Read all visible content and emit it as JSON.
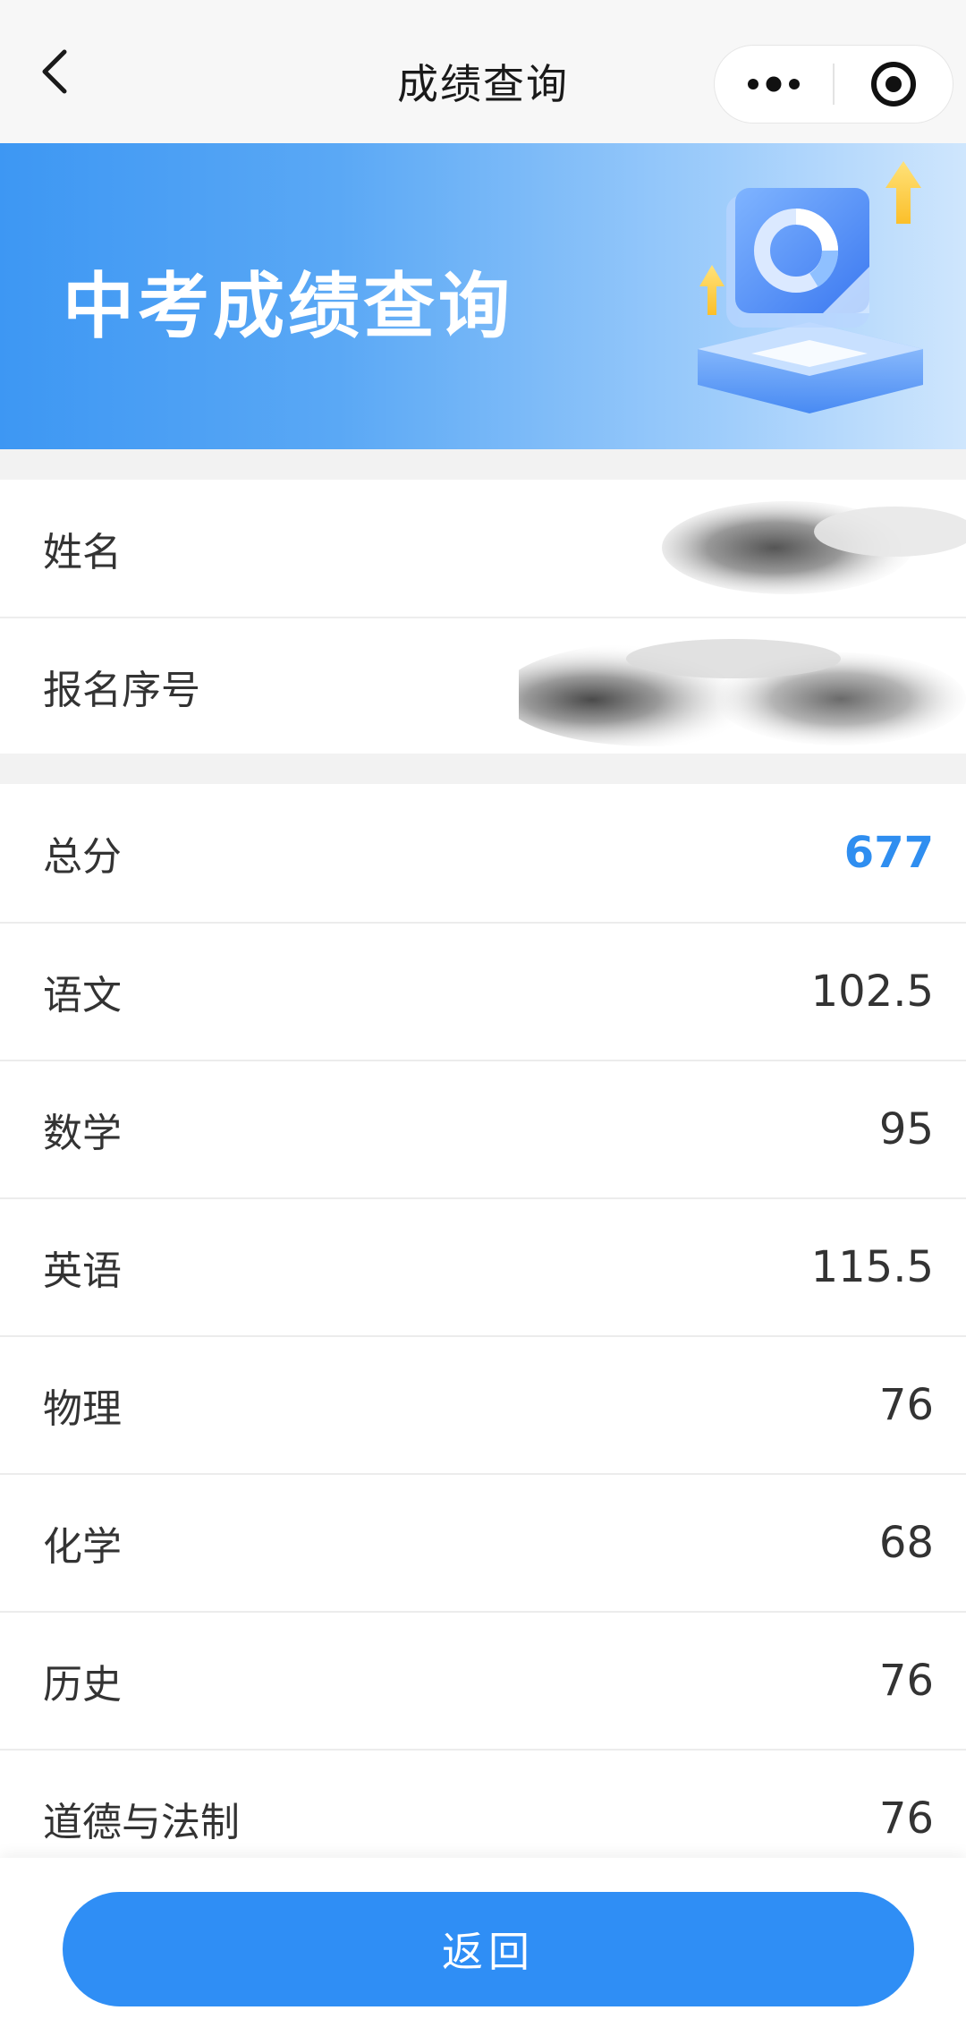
{
  "navbar": {
    "title": "成绩查询",
    "back_icon": "chevron-left-icon",
    "more_icon": "more-dots-icon",
    "close_icon": "target-circle-icon"
  },
  "banner": {
    "title": "中考成绩查询",
    "illustration_icon": "chart-monitor-illustration"
  },
  "info": {
    "rows": [
      {
        "label": "姓名",
        "value": ""
      },
      {
        "label": "报名序号",
        "value": ""
      }
    ]
  },
  "scores": {
    "rows": [
      {
        "label": "总分",
        "value": "677"
      },
      {
        "label": "语文",
        "value": "102.5"
      },
      {
        "label": "数学",
        "value": "95"
      },
      {
        "label": "英语",
        "value": "115.5"
      },
      {
        "label": "物理",
        "value": "76"
      },
      {
        "label": "化学",
        "value": "68"
      },
      {
        "label": "历史",
        "value": "76"
      },
      {
        "label": "道德与法制",
        "value": "76"
      }
    ]
  },
  "footer": {
    "return_label": "返回"
  },
  "colors": {
    "accent": "#2f8ef5",
    "total_score": "#2f8ef0",
    "banner_start": "#3d97f3",
    "banner_end": "#cfe6fd"
  }
}
